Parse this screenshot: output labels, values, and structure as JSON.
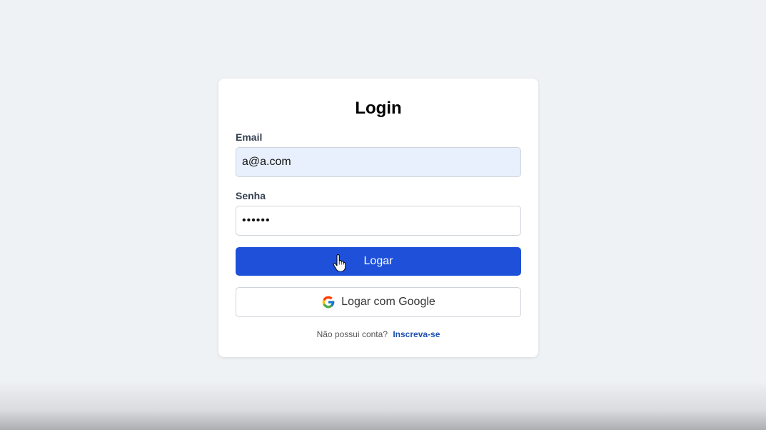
{
  "login": {
    "title": "Login",
    "email_label": "Email",
    "email_value": "a@a.com",
    "password_label": "Senha",
    "password_value": "••••••",
    "submit_label": "Logar",
    "google_label": "Logar com Google",
    "signup_prompt": "Não possui conta?",
    "signup_link": "Inscreva-se"
  },
  "colors": {
    "primary": "#1e50d9",
    "autofill": "#e8f0fe",
    "background": "#eff2f4",
    "link": "#1e50b0"
  }
}
